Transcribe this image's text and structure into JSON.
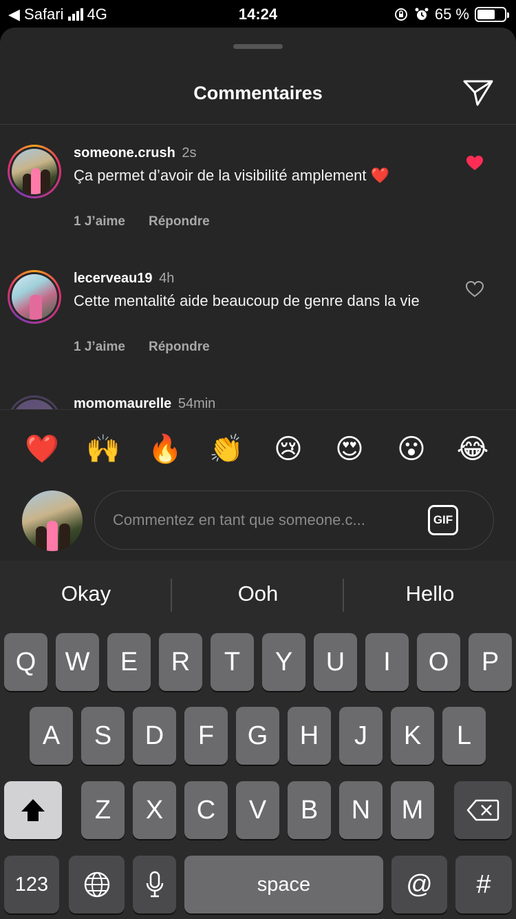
{
  "status_bar": {
    "back_label": "◀ Safari",
    "network": "4G",
    "time": "14:24",
    "battery": "65 %",
    "battery_level": 0.65
  },
  "header": {
    "title": "Commentaires"
  },
  "comments": [
    {
      "username": "someone.crush",
      "time": "2s",
      "text": "Ça permet d’avoir de la visibilité amplement ❤️",
      "likes": "1 J’aime",
      "reply": "Répondre",
      "liked": true
    },
    {
      "username": "lecerveau19",
      "time": "4h",
      "text": "Cette mentalité aide beaucoup de genre dans la vie",
      "likes": "1 J’aime",
      "reply": "Répondre",
      "liked": false
    },
    {
      "username": "momomaurelle",
      "time": "54min"
    }
  ],
  "emoji_bar": [
    "❤️",
    "🙌",
    "🔥",
    "👏",
    "😢",
    "😍",
    "😮",
    "😂"
  ],
  "comment_box": {
    "placeholder": "Commentez en tant que someone.c...",
    "gif_label": "GIF"
  },
  "keyboard": {
    "suggestions": [
      "Okay",
      "Ooh",
      "Hello"
    ],
    "row1": [
      "Q",
      "W",
      "E",
      "R",
      "T",
      "Y",
      "U",
      "I",
      "O",
      "P"
    ],
    "row2": [
      "A",
      "S",
      "D",
      "F",
      "G",
      "H",
      "J",
      "K",
      "L"
    ],
    "row3": [
      "Z",
      "X",
      "C",
      "V",
      "B",
      "N",
      "M"
    ],
    "numbers_label": "123",
    "space_label": "space",
    "at_label": "@",
    "hash_label": "#"
  },
  "colors": {
    "sheet_bg": "#262626",
    "like_red": "#ff2d55",
    "secondary_text": "#a8a8a8"
  }
}
